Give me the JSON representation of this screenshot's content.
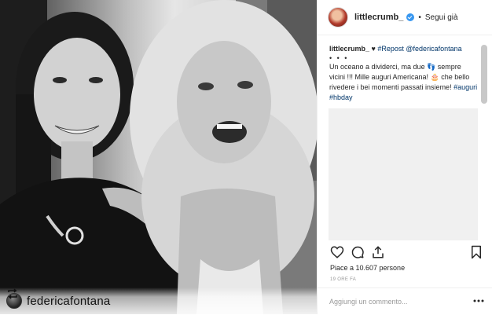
{
  "repost": {
    "username": "federicafontana"
  },
  "header": {
    "username": "littlecrumb_",
    "follow_label": "Segui già"
  },
  "caption": {
    "username": "littlecrumb_",
    "heart": "♥",
    "repost_tag": "#Repost @federicafontana",
    "dots": "• • •",
    "text_1": "Un oceano a dividerci, ma due 👣 sempre vicini !!! Mille auguri Americana! 🎂 che bello rivedere i bei momenti passati insieme!",
    "hashtag_1": "#auguri",
    "hashtag_2": "#hbday"
  },
  "stats": {
    "likes_text": "Piace a 10.607 persone",
    "time_text": "19 ORE FA"
  },
  "comment": {
    "placeholder": "Aggiungi un commento..."
  },
  "icons": {
    "heart": "heart-icon",
    "comment": "comment-icon",
    "share": "share-icon",
    "bookmark": "bookmark-icon",
    "more": "more-icon",
    "repost": "repost-icon"
  },
  "colors": {
    "link": "#003569",
    "verified": "#3897f0",
    "muted": "#999999"
  }
}
